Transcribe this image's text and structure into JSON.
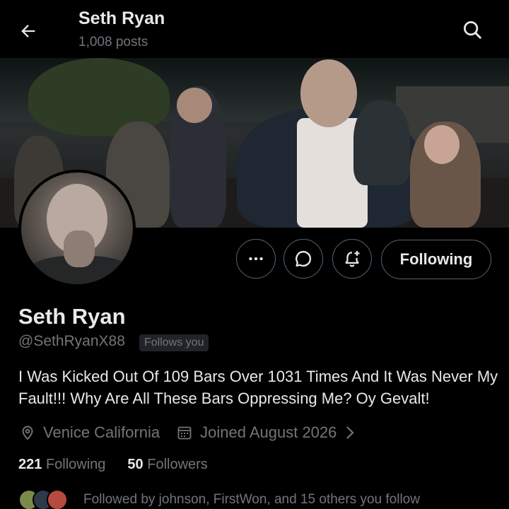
{
  "header": {
    "name": "Seth Ryan",
    "posts": "1,008 posts",
    "back_icon": "arrow-left-icon",
    "search_icon": "search-icon"
  },
  "profile": {
    "display_name": "Seth Ryan",
    "handle": "@SethRyanX88",
    "follows_you": "Follows you",
    "bio": "I Was Kicked Out Of 109 Bars Over 1031 Times And It Was Never My Fault!!! Why Are All These Bars Oppressing Me? Oy Gevalt!",
    "location": "Venice California",
    "joined": "Joined August 2026"
  },
  "actions": {
    "more_icon": "more-icon",
    "message_icon": "message-icon",
    "notify_icon": "bell-plus-icon",
    "following_label": "Following"
  },
  "counts": {
    "following_num": "221",
    "following_label": "Following",
    "followers_num": "50",
    "followers_label": "Followers"
  },
  "followed_by": {
    "text": "Followed by johnson, FirstWon, and 15 others you follow"
  },
  "colors": {
    "background": "#000000",
    "text": "#e7e9ea",
    "muted": "#71767b",
    "border": "#536471"
  }
}
